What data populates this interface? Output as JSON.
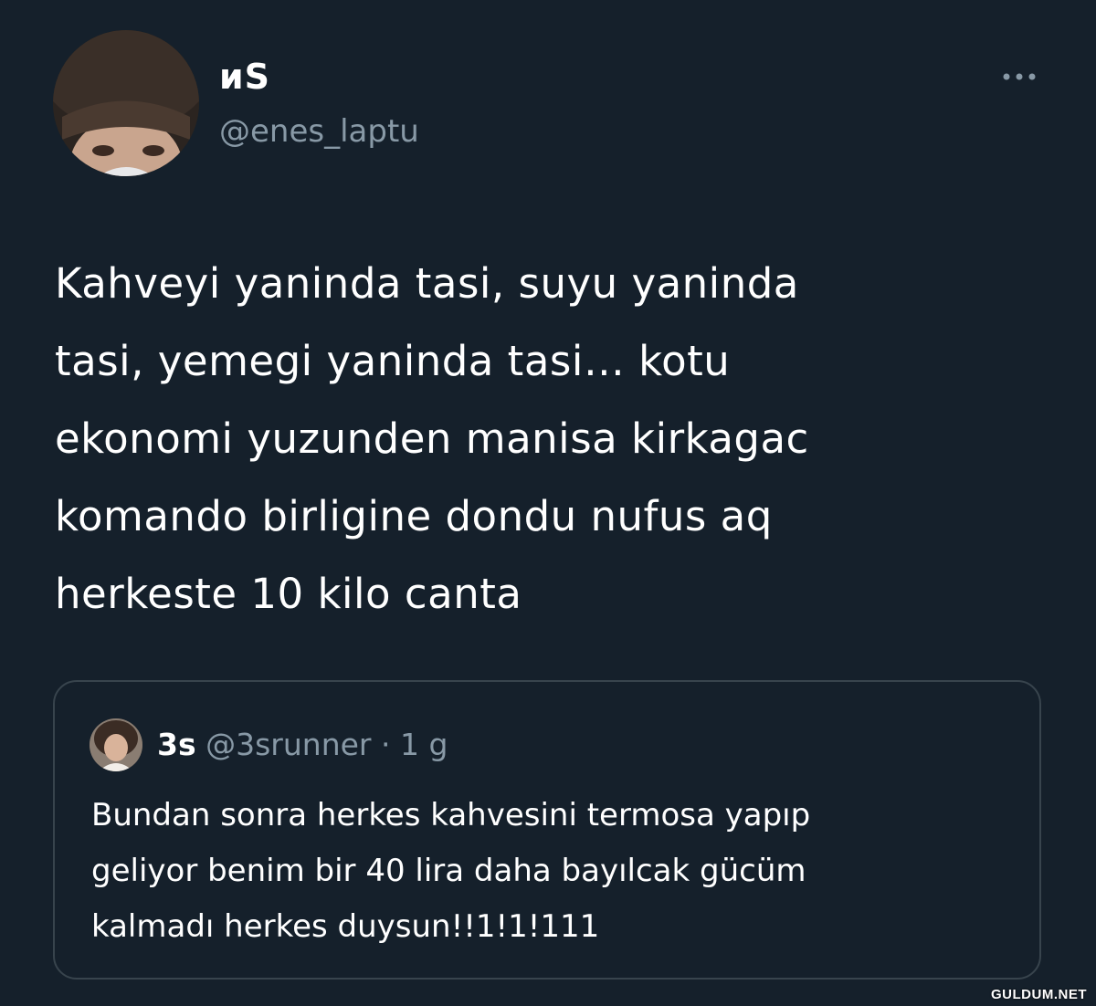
{
  "tweet": {
    "author": {
      "display_name": "ᴎS",
      "handle": "@enes_laptu",
      "avatar_icon": "user-photo-avatar"
    },
    "more_icon": "more-horizontal-icon",
    "text": "Kahveyi yaninda tasi, suyu yaninda\ntasi, yemegi yaninda tasi… kotu\nekonomi yuzunden manisa kirkagac\nkomando birligine dondu nufus aq\nherkeste 10 kilo canta"
  },
  "quoted_tweet": {
    "author": {
      "display_name": "3s",
      "handle": "@3srunner",
      "separator": "·",
      "time": "1 g",
      "avatar_icon": "user-photo-avatar"
    },
    "text": "Bundan sonra herkes kahvesini termosa yapıp\ngeliyor benim bir 40 lira daha bayılcak gücüm\nkalmadı herkes duysun!!1!1!111"
  },
  "watermark": "GULDUM.NET",
  "colors": {
    "background": "#15202b",
    "primary_text": "#ffffff",
    "secondary_text": "#8899a6",
    "border": "#38444d"
  }
}
